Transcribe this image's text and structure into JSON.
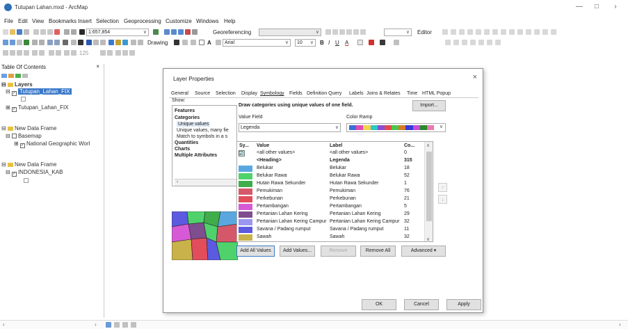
{
  "window": {
    "title": "Tutupan Lahan.mxd - ArcMap"
  },
  "menu": [
    "File",
    "Edit",
    "View",
    "Bookmarks",
    "Insert",
    "Selection",
    "Geoprocessing",
    "Customize",
    "Windows",
    "Help"
  ],
  "toolbar": {
    "scale": "1:657,854",
    "georeferencing": "Georeferencing",
    "editor": "Editor",
    "drawing": "Drawing",
    "font": "Arial",
    "font_size": "10",
    "zoom": "125"
  },
  "toc": {
    "title": "Table Of Contents",
    "layers_label": "Layers",
    "layer1": "Tutupan_Lahan_FIX",
    "layer2": "Tutupan_Lahan_FIX",
    "frame1": "New Data Frame",
    "basemap": "Basemap",
    "natgeo": "National Geographic Worl",
    "frame2": "New Data Frame",
    "indonesia": "INDONESIA_KAB"
  },
  "dialog": {
    "title": "Layer Properties",
    "tabs": [
      "General",
      "Source",
      "Selection",
      "Display",
      "Symbology",
      "Fields",
      "Definition Query",
      "Labels",
      "Joins & Relates",
      "Time",
      "HTML Popup"
    ],
    "active_tab": "Symbology",
    "show_label": "Show:",
    "show_items": [
      "Features",
      "Categories",
      "Unique values",
      "Unique values, many fie",
      "Match to symbols in a s",
      "Quantities",
      "Charts",
      "Multiple Attributes"
    ],
    "heading": "Draw categories using unique values of one field.",
    "import_label": "Import...",
    "value_field_label": "Value Field",
    "value_field": "Legenda",
    "color_ramp_label": "Color Ramp",
    "columns": {
      "symbol": "Sy...",
      "value": "Value",
      "label": "Label",
      "count": "Co..."
    },
    "rows": [
      {
        "value": "<all other values>",
        "label": "<all other values>",
        "count": "0",
        "color": "#c8f0ee"
      },
      {
        "value": "<Heading>",
        "label": "Legenda",
        "count": "315",
        "color": ""
      },
      {
        "value": "Belukar",
        "label": "Belukar",
        "count": "18",
        "color": "#5aa7e0"
      },
      {
        "value": "Belukar Rawa",
        "label": "Belukar Rawa",
        "count": "52",
        "color": "#4fd26b"
      },
      {
        "value": "Hutan Rawa Sekunder",
        "label": "Hutan Rawa Sekunder",
        "count": "1",
        "color": "#3fae4a"
      },
      {
        "value": "Pemukiman",
        "label": "Pemukiman",
        "count": "76",
        "color": "#d5586a"
      },
      {
        "value": "Perkebunan",
        "label": "Perkebunan",
        "count": "21",
        "color": "#e14d5b"
      },
      {
        "value": "Pertambangan",
        "label": "Pertambangan",
        "count": "5",
        "color": "#d65ad6"
      },
      {
        "value": "Pertanian Lahan Kering",
        "label": "Pertanian Lahan Kering",
        "count": "29",
        "color": "#7e4e8e"
      },
      {
        "value": "Pertanian Lahan Kering Campur",
        "label": "Pertanian Lahan Kering Campur",
        "count": "32",
        "color": "#9a97f0"
      },
      {
        "value": "Savana / Padang rumput",
        "label": "Savana / Padang rumput",
        "count": "11",
        "color": "#5b5ae0"
      },
      {
        "value": "Sawah",
        "label": "Sawah",
        "count": "32",
        "color": "#c9b24a"
      }
    ],
    "buttons": {
      "add_all": "Add All Values",
      "add": "Add Values...",
      "remove": "Remove",
      "remove_all": "Remove All",
      "advanced": "Advanced",
      "ok": "OK",
      "cancel": "Cancel",
      "apply": "Apply"
    },
    "ramp_colors": [
      "#3b6fd6",
      "#e34ab8",
      "#f2d44a",
      "#2fc8c8",
      "#8b4ed0",
      "#e24a4a",
      "#48c84a",
      "#d67a2a",
      "#3a3ad6",
      "#c84ad6",
      "#2a8a2a",
      "#e87ab0"
    ]
  }
}
